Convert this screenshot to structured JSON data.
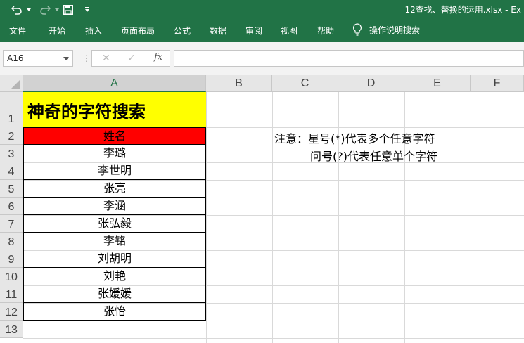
{
  "titlebar": {
    "file_title": "12查找、替换的运用.xlsx  -  Ex"
  },
  "ribbon": {
    "tabs": [
      "文件",
      "开始",
      "插入",
      "页面布局",
      "公式",
      "数据",
      "审阅",
      "视图",
      "帮助"
    ],
    "tell_me": "操作说明搜索"
  },
  "formula_bar": {
    "name_box": "A16",
    "fx_label": "fx",
    "formula": ""
  },
  "grid": {
    "columns": [
      "A",
      "B",
      "C",
      "D",
      "E",
      "F"
    ],
    "selected_column": "A",
    "rows": [
      "1",
      "2",
      "3",
      "4",
      "5",
      "6",
      "7",
      "8",
      "9",
      "10",
      "11",
      "12",
      "13"
    ],
    "title": "神奇的字符搜索",
    "name_header": "姓名",
    "names": [
      "李璐",
      "李世明",
      "张亮",
      "李涵",
      "张弘毅",
      "李铭",
      "刘胡明",
      "刘艳",
      "张媛媛",
      "张怡"
    ],
    "note_line1": "注意：星号(*)代表多个任意字符",
    "note_line2": "问号(?)代表任意单个字符"
  },
  "colors": {
    "excel_green": "#217346",
    "title_fill": "#ffff00",
    "header_fill": "#ff0000"
  }
}
